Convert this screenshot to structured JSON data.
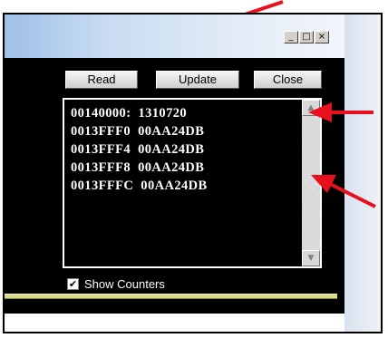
{
  "window": {
    "controls": {
      "minimize": "_",
      "maximize": "□",
      "close": "×"
    }
  },
  "toolbar": {
    "read_label": "Read",
    "update_label": "Update",
    "close_label": "Close"
  },
  "dump_rows": [
    "00140000:  1310720",
    "0013FFF0  00AA24DB",
    "0013FFF4  00AA24DB",
    "0013FFF8  00AA24DB",
    "0013FFFC  00AA24DB"
  ],
  "scrollbar": {
    "up_glyph": "▲",
    "down_glyph": "▼"
  },
  "show_counters": {
    "label": "Show Counters",
    "checked": true,
    "check_glyph": "✔"
  },
  "colors": {
    "annotation_arrow": "#e8101c",
    "client_bg": "#000000",
    "text": "#ffffff"
  }
}
